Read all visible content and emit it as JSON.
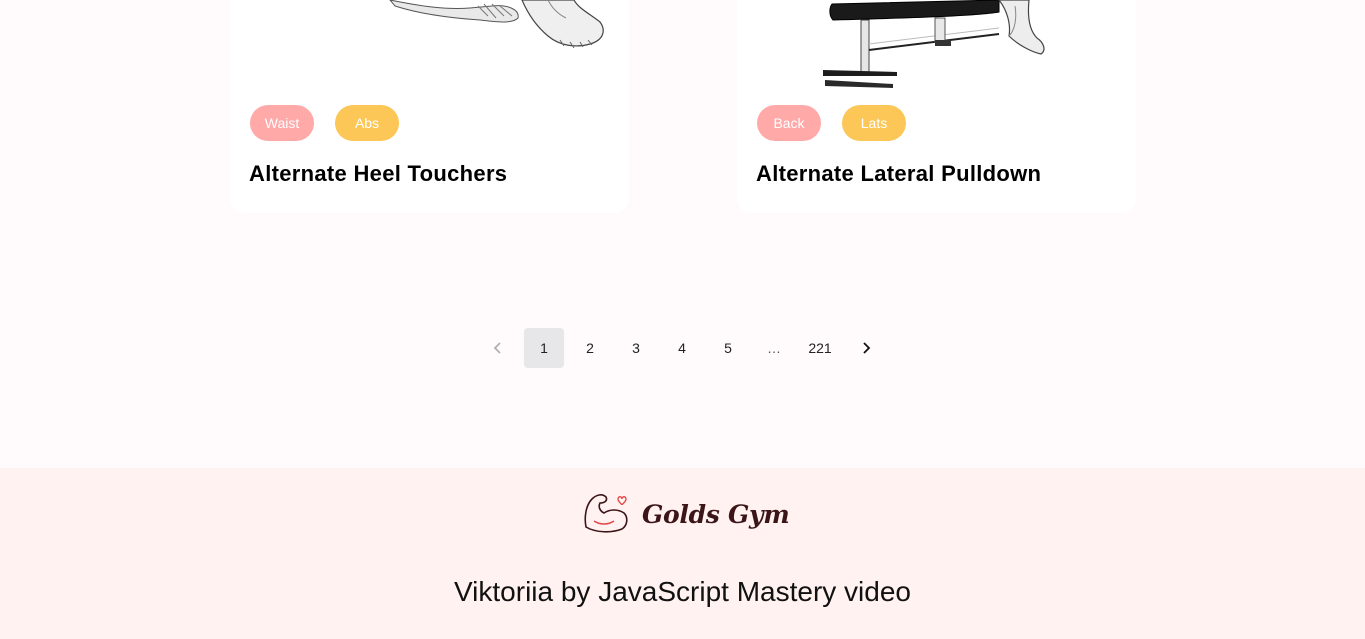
{
  "cards": [
    {
      "image_alt": "exercise illustration",
      "tags": [
        "Waist",
        "Abs"
      ],
      "title": "Alternate Heel Touchers"
    },
    {
      "image_alt": "exercise illustration",
      "tags": [
        "Back",
        "Lats"
      ],
      "title": "Alternate Lateral Pulldown"
    }
  ],
  "pagination": {
    "prev_icon": "chevron-left-icon",
    "pages": [
      "1",
      "2",
      "3",
      "4",
      "5"
    ],
    "active_page": "1",
    "ellipsis": "…",
    "last_page": "221",
    "next_icon": "chevron-right-icon"
  },
  "footer": {
    "logo_text": "Golds Gym",
    "logo_icon": "flexed-arm-heart-icon",
    "credit": "Viktoriia by JavaScript Mastery video"
  },
  "colors": {
    "tag_primary": "#ffa9a9",
    "tag_secondary": "#fcc757",
    "footer_bg": "#fff2f1",
    "page_bg": "#fffafb"
  }
}
